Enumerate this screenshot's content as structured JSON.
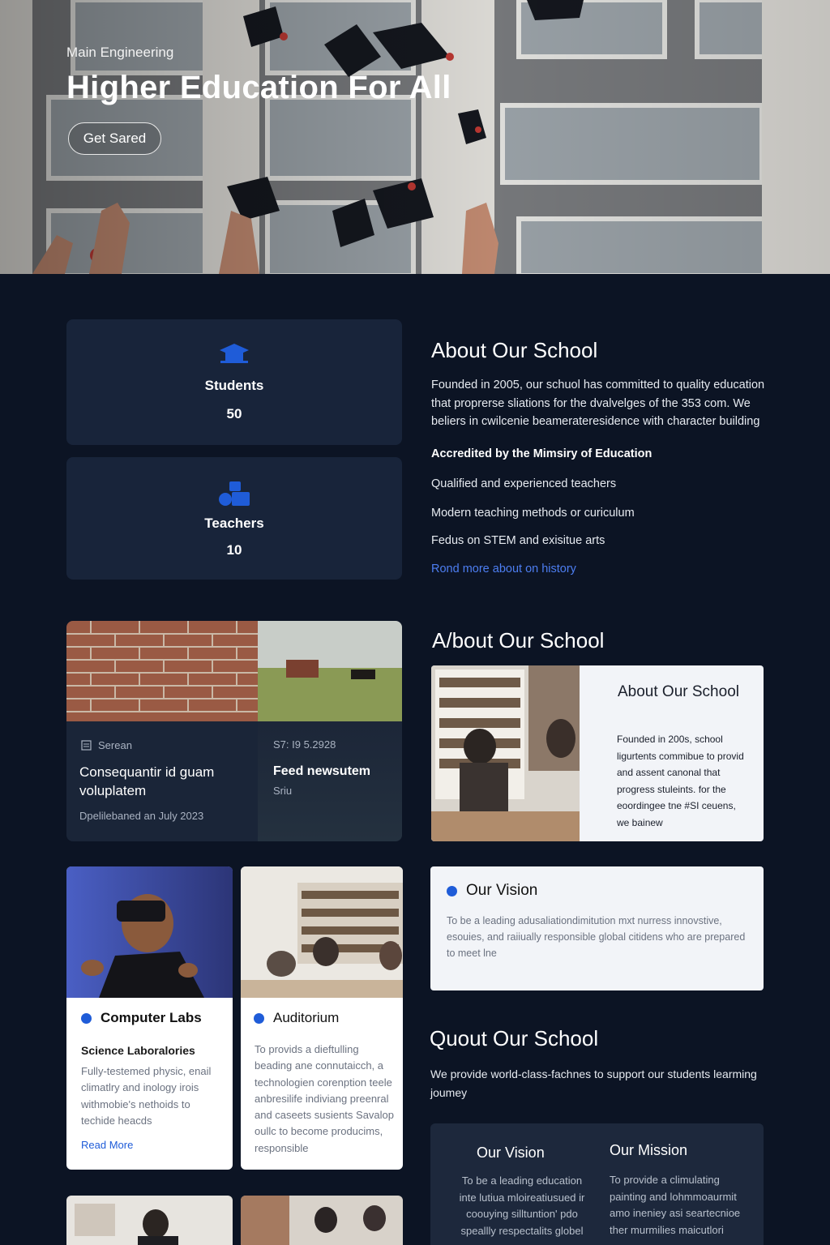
{
  "hero": {
    "subtitle": "Main Engineering",
    "title": "Higher Education For All",
    "button": "Get Sared"
  },
  "stats": [
    {
      "label": "Students",
      "value": "50",
      "icon": "graduation-cap-icon"
    },
    {
      "label": "Teachers",
      "value": "10",
      "icon": "teacher-shapes-icon"
    }
  ],
  "about": {
    "title": "About Our School",
    "paragraph": "Founded in 2005, our schuol has committed to quality education that proprerse sliations for the dvalvelges of the 353 com. We beliers in cwilcenie beamerateresidence with character building",
    "items": [
      "Accredited by the Mimsiry of Education",
      "Qualified and experienced teachers",
      "Modern teaching methods or curiculum",
      "Fedus on STEM and exisitue arts"
    ],
    "link": "Rond more about on history"
  },
  "news": {
    "left": {
      "label": "Serean",
      "headline": "Consequantir id guam voluplatem",
      "date": "Dpelilebaned an July 2023"
    },
    "right": {
      "label": "S7: I9 5.2928",
      "headline": "Feed newsutem",
      "sub": "Sriu"
    }
  },
  "about2": {
    "title": "A/bout Our School",
    "card_title": "About Our School",
    "card_text": "Founded in 200s, school ligurtents commibue to provid and assent canonal that progress stuleints. for the eoordingee tne #SI ceuens, we bainew"
  },
  "facilities": [
    {
      "title": "Computer Labs",
      "subtitle": "Science Laboralories",
      "text": "Fully-testemed physic, enail climatlry and inology irois withmobie's nethoids to techide heacds",
      "link": "Read More"
    },
    {
      "title": "Auditorium",
      "text": "To provids a dieftulling beading ane connutaicch, a technologien corenption teele anbresilife indiviang preenral and caseets susients Savalop oullc to become producims, responsible"
    }
  ],
  "vision": {
    "title": "Our Vision",
    "text": "To be a leading adusaliationdimitution mxt nurress innovstive, esouies, and raiiually responsible global citidens who are prepared to meet lne"
  },
  "about3": {
    "title": "Quout Our School",
    "text": "We provide world-class-fachnes to support our students learming joumey"
  },
  "vision_mission": {
    "vision_title": "Our Vision",
    "vision_text": "To be a leading education inte lutiua mloireatiusued ir coouying silltuntion' pdo speallly respectalits globel",
    "mission_title": "Our Mission",
    "mission_text": "To provide a climulating painting and lohmmoaurmit amo ineniey asi seartecnioe ther murmilies maicutlori"
  },
  "colors": {
    "background": "#0c1424",
    "card": "#18243a",
    "accent": "#1f5cd8",
    "link": "#4d7ef2"
  }
}
